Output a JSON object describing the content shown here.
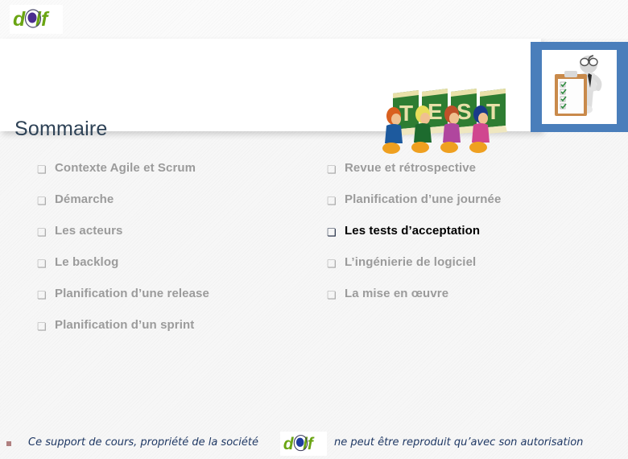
{
  "brand": {
    "logo_text": "dolf",
    "logo_green": "#6aa513",
    "logo_purple": "#4b2d8f",
    "logo_blue": "#1f3d9e"
  },
  "header": {
    "title": "Sommaire",
    "title_color": "#2e4256",
    "test_artwork_letters": [
      "T",
      "E",
      "S",
      "T"
    ],
    "test_artwork_name": "test-clipart",
    "panel_color": "#4a7ebb",
    "panel_image_name": "checklist-figure-photo",
    "checklist_marks": [
      "✓",
      "✓",
      "✓",
      "✓",
      "✓"
    ]
  },
  "agenda": {
    "left_column": [
      {
        "bullet": "❏",
        "label": "Contexte Agile et Scrum",
        "active": false
      },
      {
        "bullet": "❏",
        "label": "Démarche",
        "active": false
      },
      {
        "bullet": "❏",
        "label": "Les acteurs",
        "active": false
      },
      {
        "bullet": "❏",
        "label": "Le backlog",
        "active": false
      },
      {
        "bullet": "❏",
        "label": "Planification d’une release",
        "active": false
      },
      {
        "bullet": "❏",
        "label": "Planification d’un sprint",
        "active": false
      }
    ],
    "right_column": [
      {
        "bullet": "❏",
        "label": "Revue et rétrospective",
        "active": false
      },
      {
        "bullet": "❏",
        "label": "Planification d’une  journée",
        "active": false
      },
      {
        "bullet": "❏",
        "label": "Les tests d’acceptation",
        "active": true
      },
      {
        "bullet": "❏",
        "label": "L’ingénierie de logiciel",
        "active": false
      },
      {
        "bullet": "❏",
        "label": "La mise en œuvre",
        "active": false
      }
    ],
    "inactive_color": "#9b9b9b",
    "active_color": "#000000"
  },
  "footer": {
    "bullet": "▪",
    "text_before_logo": "Ce support de cours,  propriété de la société",
    "logo_text": "dolf",
    "text_after_logo": "ne peut être reproduit qu’avec son  autorisation",
    "text_color": "#1f3864"
  }
}
